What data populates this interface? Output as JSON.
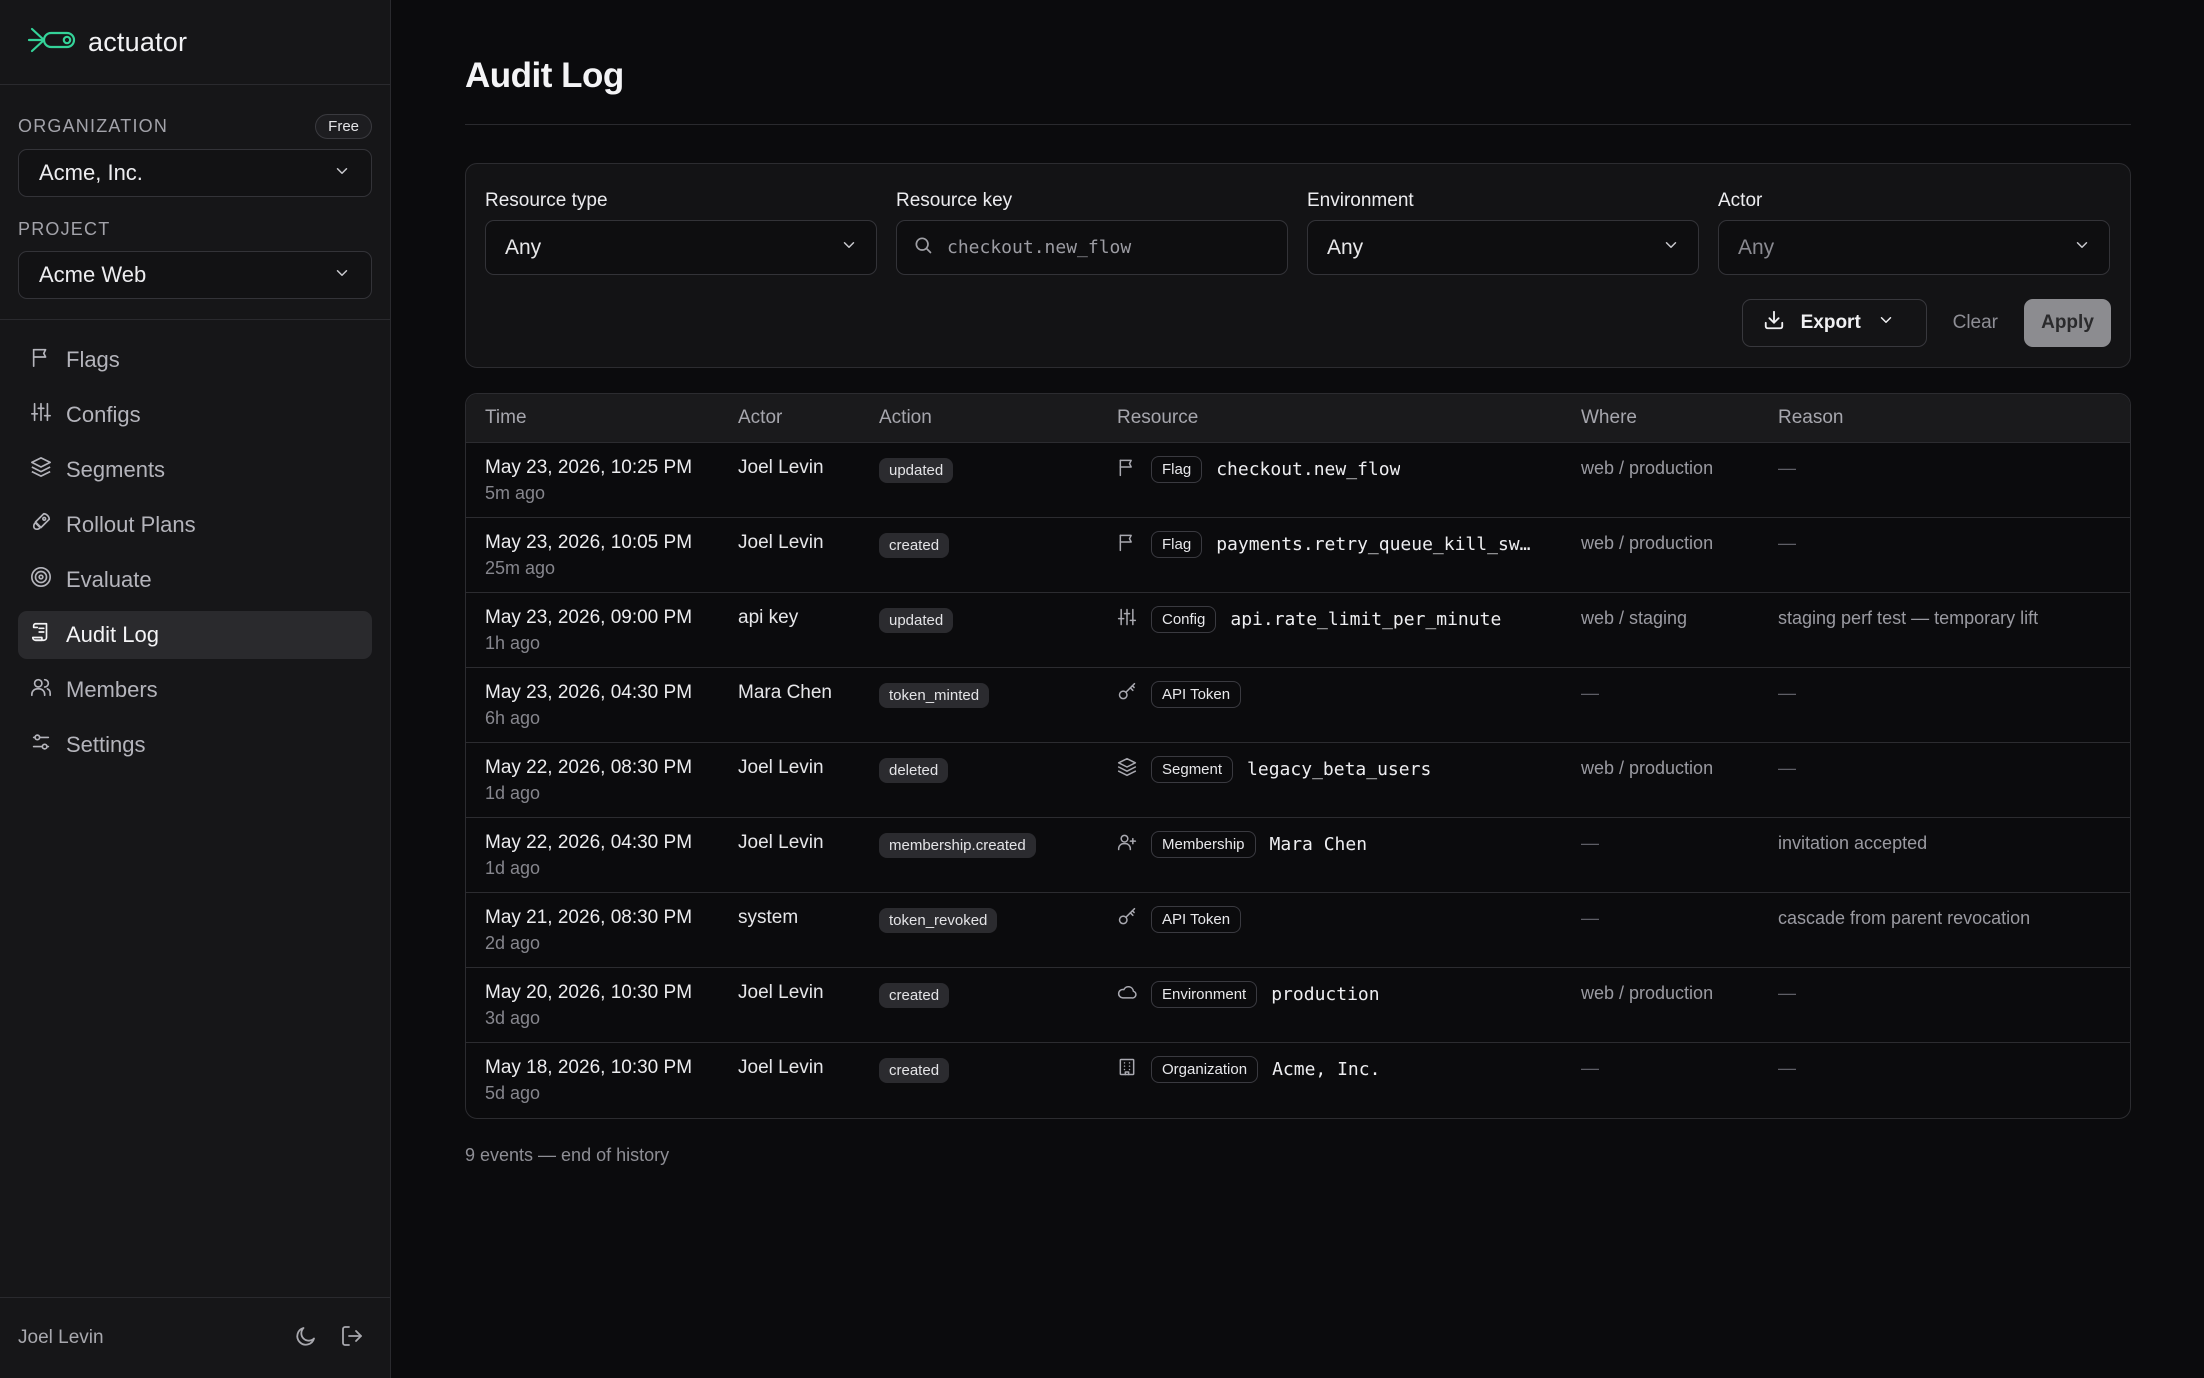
{
  "app": {
    "name": "actuator",
    "accent": "#34d399"
  },
  "sidebar": {
    "organization_label": "ORGANIZATION",
    "plan_badge": "Free",
    "organization_value": "Acme, Inc.",
    "project_label": "PROJECT",
    "project_value": "Acme Web",
    "nav": [
      {
        "label": "Flags",
        "icon": "flag-icon"
      },
      {
        "label": "Configs",
        "icon": "sliders-icon"
      },
      {
        "label": "Segments",
        "icon": "layers-icon"
      },
      {
        "label": "Rollout Plans",
        "icon": "rocket-icon"
      },
      {
        "label": "Evaluate",
        "icon": "target-icon"
      },
      {
        "label": "Audit Log",
        "icon": "scroll-icon",
        "active": true
      },
      {
        "label": "Members",
        "icon": "users-icon"
      },
      {
        "label": "Settings",
        "icon": "settings-icon"
      }
    ],
    "footer_user": "Joel Levin"
  },
  "page": {
    "title": "Audit Log"
  },
  "filters": {
    "resource_type": {
      "label": "Resource type",
      "value": "Any"
    },
    "resource_key": {
      "label": "Resource key",
      "placeholder": "checkout.new_flow"
    },
    "environment": {
      "label": "Environment",
      "value": "Any"
    },
    "actor": {
      "label": "Actor",
      "value": "Any"
    },
    "export_label": "Export",
    "clear_label": "Clear",
    "apply_label": "Apply"
  },
  "table": {
    "columns": [
      "Time",
      "Actor",
      "Action",
      "Resource",
      "Where",
      "Reason"
    ],
    "rows": [
      {
        "time": "May 23, 2026, 10:25 PM",
        "rel": "5m ago",
        "actor": "Joel Levin",
        "action": "updated",
        "res_icon": "flag-icon",
        "res_type": "Flag",
        "res_key": "checkout.new_flow",
        "where": "web / production",
        "reason": "—"
      },
      {
        "time": "May 23, 2026, 10:05 PM",
        "rel": "25m ago",
        "actor": "Joel Levin",
        "action": "created",
        "res_icon": "flag-icon",
        "res_type": "Flag",
        "res_key": "payments.retry_queue_kill_sw…",
        "where": "web / production",
        "reason": "—"
      },
      {
        "time": "May 23, 2026, 09:00 PM",
        "rel": "1h ago",
        "actor": "api key",
        "action": "updated",
        "res_icon": "sliders-icon",
        "res_type": "Config",
        "res_key": "api.rate_limit_per_minute",
        "where": "web / staging",
        "reason": "staging perf test — temporary lift"
      },
      {
        "time": "May 23, 2026, 04:30 PM",
        "rel": "6h ago",
        "actor": "Mara Chen",
        "action": "token_minted",
        "res_icon": "key-icon",
        "res_type": "API Token",
        "res_key": "",
        "where": "—",
        "reason": "—"
      },
      {
        "time": "May 22, 2026, 08:30 PM",
        "rel": "1d ago",
        "actor": "Joel Levin",
        "action": "deleted",
        "res_icon": "layers-icon",
        "res_type": "Segment",
        "res_key": "legacy_beta_users",
        "where": "web / production",
        "reason": "—"
      },
      {
        "time": "May 22, 2026, 04:30 PM",
        "rel": "1d ago",
        "actor": "Joel Levin",
        "action": "membership.created",
        "res_icon": "user-plus-icon",
        "res_type": "Membership",
        "res_key": "Mara Chen",
        "where": "—",
        "reason": "invitation accepted"
      },
      {
        "time": "May 21, 2026, 08:30 PM",
        "rel": "2d ago",
        "actor": "system",
        "action": "token_revoked",
        "res_icon": "key-icon",
        "res_type": "API Token",
        "res_key": "",
        "where": "—",
        "reason": "cascade from parent revocation"
      },
      {
        "time": "May 20, 2026, 10:30 PM",
        "rel": "3d ago",
        "actor": "Joel Levin",
        "action": "created",
        "res_icon": "cloud-icon",
        "res_type": "Environment",
        "res_key": "production",
        "where": "web / production",
        "reason": "—"
      },
      {
        "time": "May 18, 2026, 10:30 PM",
        "rel": "5d ago",
        "actor": "Joel Levin",
        "action": "created",
        "res_icon": "building-icon",
        "res_type": "Organization",
        "res_key": "Acme, Inc.",
        "where": "—",
        "reason": "—"
      }
    ],
    "footer": "9 events — end of history"
  }
}
